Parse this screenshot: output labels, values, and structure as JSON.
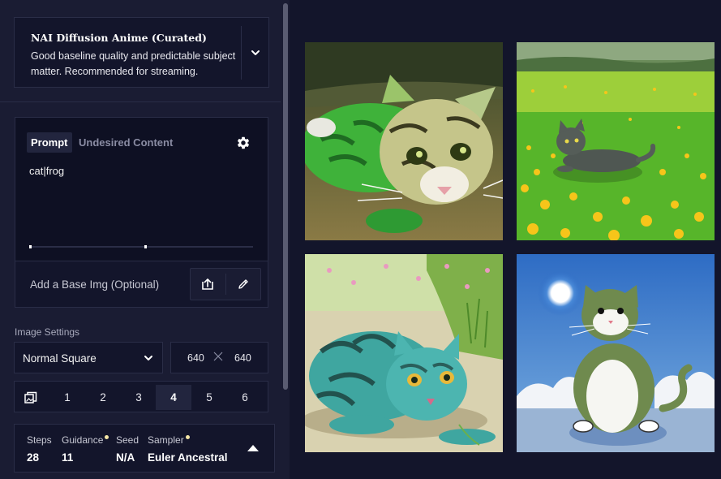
{
  "model": {
    "name": "NAI Diffusion Anime (Curated)",
    "description": "Good baseline quality and predictable subject matter. Recommended for streaming."
  },
  "prompt": {
    "tabs": [
      "Prompt",
      "Undesired Content"
    ],
    "text": "cat|frog"
  },
  "base_image": {
    "label": "Add a Base Img (Optional)"
  },
  "image_settings": {
    "label": "Image Settings",
    "size_preset": "Normal Square",
    "width": "640",
    "height": "640",
    "counts": [
      "1",
      "2",
      "3",
      "4",
      "5",
      "6"
    ],
    "selected_count": "4"
  },
  "params": {
    "steps": {
      "label": "Steps",
      "value": "28"
    },
    "guidance": {
      "label": "Guidance",
      "value": "11"
    },
    "seed": {
      "label": "Seed",
      "value": "N/A"
    },
    "sampler": {
      "label": "Sampler",
      "value": "Euler Ancestral"
    }
  },
  "gallery": {
    "images": [
      "green-tiger-cat-icon",
      "grey-cat-flower-field-icon",
      "teal-striped-cat-icon",
      "green-white-cat-sky-icon"
    ]
  },
  "colors": {
    "background": "#13152b",
    "sidebar": "#1a1c33",
    "border": "#2a2d47",
    "active": "#22253e",
    "accent_dot": "#f5e6a6"
  }
}
